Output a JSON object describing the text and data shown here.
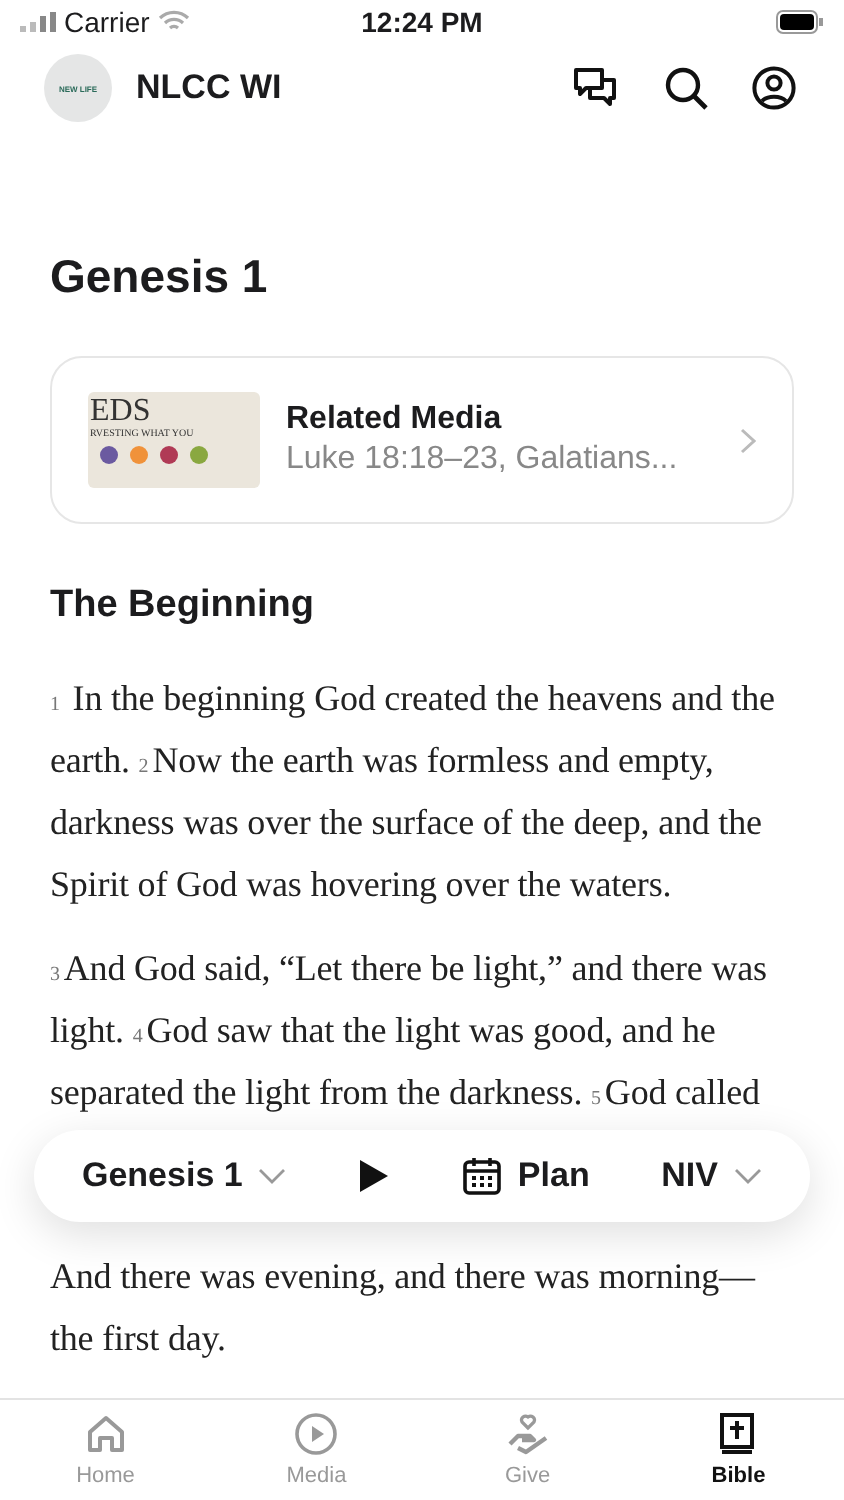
{
  "status_bar": {
    "carrier": "Carrier",
    "time": "12:24 PM"
  },
  "header": {
    "logo_text": "NEW LIFE",
    "title": "NLCC WI"
  },
  "chapter_title": "Genesis 1",
  "related_media": {
    "title": "Related Media",
    "subtitle": "Luke 18:18–23, Galatians...",
    "thumbnail_line_1": "EDS",
    "thumbnail_line_2": "RVESTING WHAT YOU"
  },
  "section_heading": "The Beginning",
  "paragraphs": [
    "$_{1}$ In the beginning God created the heavens and the earth. $_{2}$Now the earth was formless and empty, darkness was over the surface of the deep, and the Spirit of God was hovering over the waters.",
    "$_{3}$And God said, “Let there be light,” and there was light. $_{4}$God saw that the light was good, and he separated the light from the darkness. $_{5}$God called",
    "And there was evening, and there was morning—the first day."
  ],
  "reader_bar": {
    "chapter": "Genesis 1",
    "plan": "Plan",
    "version": "NIV"
  },
  "tabs": [
    {
      "label": "Home",
      "kind": "home",
      "selected": false
    },
    {
      "label": "Media",
      "kind": "media",
      "selected": false
    },
    {
      "label": "Give",
      "kind": "give",
      "selected": false
    },
    {
      "label": "Bible",
      "kind": "bible",
      "selected": true
    }
  ]
}
